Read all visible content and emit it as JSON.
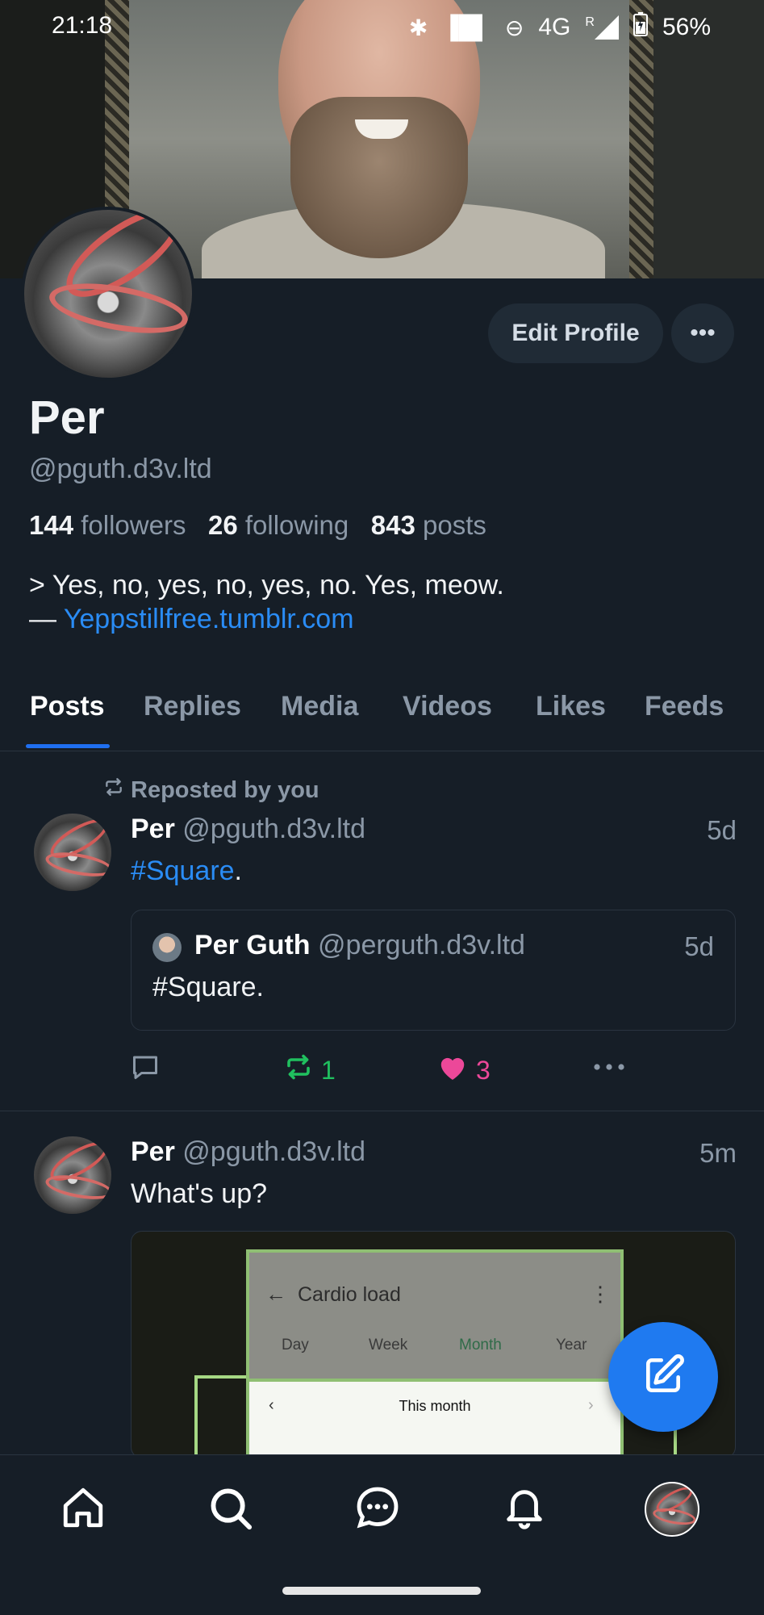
{
  "status_bar": {
    "time": "21:18",
    "network": "4G",
    "roaming": "R",
    "battery": "56%"
  },
  "profile": {
    "edit_label": "Edit Profile",
    "more_label": "•••",
    "name": "Per",
    "handle": "@pguth.d3v.ltd",
    "followers_count": "144",
    "followers_label": "followers",
    "following_count": "26",
    "following_label": "following",
    "posts_count": "843",
    "posts_label": "posts",
    "bio_line1": "> Yes, no, yes, no, yes, no. Yes, meow.",
    "bio_prefix": "— ",
    "bio_link": "Yeppstillfree.tumblr.com"
  },
  "tabs": [
    {
      "label": "Posts",
      "active": true
    },
    {
      "label": "Replies"
    },
    {
      "label": "Media"
    },
    {
      "label": "Videos"
    },
    {
      "label": "Likes"
    },
    {
      "label": "Feeds"
    }
  ],
  "posts": [
    {
      "repost_label": "Reposted by you",
      "author_name": "Per",
      "author_handle": "@pguth.d3v.ltd",
      "time": "5d",
      "text_tag": "#Square",
      "text_rest": ".",
      "quote": {
        "author_name": "Per Guth",
        "author_handle": "@perguth.d3v.ltd",
        "time": "5d",
        "text": "#Square."
      },
      "reply_count": "",
      "repost_count": "1",
      "like_count": "3"
    },
    {
      "author_name": "Per",
      "author_handle": "@pguth.d3v.ltd",
      "time": "5m",
      "text": "What's up?",
      "image": {
        "title": "Cardio load",
        "periods": [
          "Day",
          "Week",
          "Month",
          "Year"
        ],
        "selected_period": "Month",
        "range_label": "This month"
      }
    }
  ],
  "colors": {
    "background": "#161e27",
    "accent": "#1f7af0",
    "link": "#2a8cf5",
    "repost": "#20c05f",
    "like": "#ec4899"
  },
  "bottom_nav": [
    "home-icon",
    "search-icon",
    "chat-icon",
    "bell-icon",
    "profile-avatar"
  ]
}
